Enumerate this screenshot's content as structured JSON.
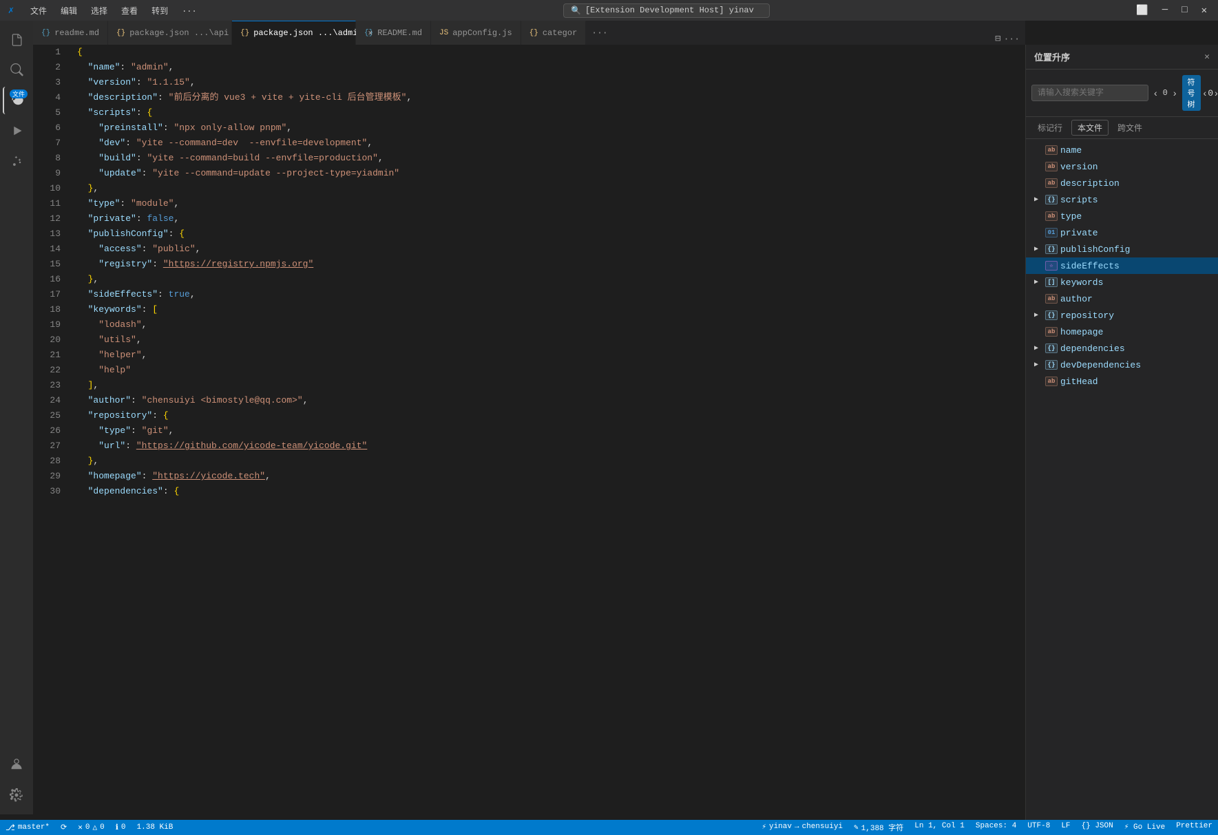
{
  "titlebar": {
    "icon": "✗",
    "menus": [
      "文件",
      "编辑",
      "选择",
      "查看",
      "转到",
      "..."
    ],
    "search_text": "[Extension Development Host] yinav",
    "window_controls": [
      "─",
      "□",
      "✕"
    ]
  },
  "tabs": [
    {
      "id": "readme",
      "icon": "{}",
      "label": "readme.md",
      "active": false,
      "modified": false
    },
    {
      "id": "package-api",
      "icon": "{}",
      "label": "package.json ...\\api",
      "active": false,
      "modified": false
    },
    {
      "id": "package-admin",
      "icon": "{}",
      "label": "package.json ...\\admin",
      "active": true,
      "modified": false
    },
    {
      "id": "readme2",
      "icon": "{}",
      "label": "README.md",
      "active": false,
      "modified": false
    },
    {
      "id": "appconfig",
      "icon": "JS",
      "label": "appConfig.js",
      "active": false,
      "modified": false
    },
    {
      "id": "categor",
      "icon": "{}",
      "label": "categor",
      "active": false,
      "modified": false
    }
  ],
  "editor": {
    "lines": [
      {
        "num": 1,
        "content": "{"
      },
      {
        "num": 2,
        "content": "  \"name\": \"admin\","
      },
      {
        "num": 3,
        "content": "  \"version\": \"1.1.15\","
      },
      {
        "num": 4,
        "content": "  \"description\": \"前后分离的 vue3 + vite + yite-cli 后台管理模板\","
      },
      {
        "num": 5,
        "content": "  \"scripts\": {"
      },
      {
        "num": 6,
        "content": "    \"preinstall\": \"npx only-allow pnpm\","
      },
      {
        "num": 7,
        "content": "    \"dev\": \"yite --command=dev  --envfile=development\","
      },
      {
        "num": 8,
        "content": "    \"build\": \"yite --command=build --envfile=production\","
      },
      {
        "num": 9,
        "content": "    \"update\": \"yite --command=update --project-type=yiadmin\""
      },
      {
        "num": 10,
        "content": "  },"
      },
      {
        "num": 11,
        "content": "  \"type\": \"module\","
      },
      {
        "num": 12,
        "content": "  \"private\": false,"
      },
      {
        "num": 13,
        "content": "  \"publishConfig\": {"
      },
      {
        "num": 14,
        "content": "    \"access\": \"public\","
      },
      {
        "num": 15,
        "content": "    \"registry\": \"https://registry.npmjs.org\""
      },
      {
        "num": 16,
        "content": "  },"
      },
      {
        "num": 17,
        "content": "  \"sideEffects\": true,"
      },
      {
        "num": 18,
        "content": "  \"keywords\": ["
      },
      {
        "num": 19,
        "content": "    \"lodash\","
      },
      {
        "num": 20,
        "content": "    \"utils\","
      },
      {
        "num": 21,
        "content": "    \"helper\","
      },
      {
        "num": 22,
        "content": "    \"help\""
      },
      {
        "num": 23,
        "content": "  ],"
      },
      {
        "num": 24,
        "content": "  \"author\": \"chensuiyi <bimostyle@qq.com>\","
      },
      {
        "num": 25,
        "content": "  \"repository\": {"
      },
      {
        "num": 26,
        "content": "    \"type\": \"git\","
      },
      {
        "num": 27,
        "content": "    \"url\": \"https://github.com/yicode-team/yicode.git\""
      },
      {
        "num": 28,
        "content": "  },"
      },
      {
        "num": 29,
        "content": "  \"homepage\": \"https://yicode.tech\","
      },
      {
        "num": 30,
        "content": "  \"dependencies\": {"
      }
    ]
  },
  "right_panel": {
    "title": "位置升序",
    "search_placeholder": "请输入搜索关键字",
    "nav_count_left": "0",
    "nav_count_right": "0",
    "search_type_btn": "符号树",
    "filter_btns": [
      "标记行",
      "本文件",
      "跨文件"
    ],
    "active_filter": "本文件",
    "tree_items": [
      {
        "id": "name",
        "label": "name",
        "type": "string",
        "type_label": "ab",
        "indent": 0,
        "arrow": "leaf",
        "expanded": false
      },
      {
        "id": "version",
        "label": "version",
        "type": "string",
        "type_label": "ab",
        "indent": 0,
        "arrow": "leaf",
        "expanded": false
      },
      {
        "id": "description",
        "label": "description",
        "type": "string",
        "type_label": "ab",
        "indent": 0,
        "arrow": "leaf",
        "expanded": false
      },
      {
        "id": "scripts",
        "label": "scripts",
        "type": "object",
        "type_label": "{}",
        "indent": 0,
        "arrow": "collapsed",
        "expanded": false
      },
      {
        "id": "type",
        "label": "type",
        "type": "string",
        "type_label": "ab",
        "indent": 0,
        "arrow": "leaf",
        "expanded": false
      },
      {
        "id": "private",
        "label": "private",
        "type": "bool",
        "type_label": "01",
        "indent": 0,
        "arrow": "leaf",
        "expanded": false
      },
      {
        "id": "publishConfig",
        "label": "publishConfig",
        "type": "object",
        "type_label": "{}",
        "indent": 0,
        "arrow": "collapsed",
        "expanded": false
      },
      {
        "id": "sideEffects",
        "label": "sideEffects",
        "type": "bool",
        "type_label": "☆",
        "indent": 0,
        "arrow": "leaf",
        "expanded": false,
        "selected": true
      },
      {
        "id": "keywords",
        "label": "keywords",
        "type": "array",
        "type_label": "[]",
        "indent": 0,
        "arrow": "collapsed",
        "expanded": false
      },
      {
        "id": "author",
        "label": "author",
        "type": "string",
        "type_label": "ab",
        "indent": 0,
        "arrow": "leaf",
        "expanded": false
      },
      {
        "id": "repository",
        "label": "repository",
        "type": "object",
        "type_label": "{}",
        "indent": 0,
        "arrow": "collapsed",
        "expanded": false
      },
      {
        "id": "homepage",
        "label": "homepage",
        "type": "string",
        "type_label": "ab",
        "indent": 0,
        "arrow": "leaf",
        "expanded": false
      },
      {
        "id": "dependencies",
        "label": "dependencies",
        "type": "object",
        "type_label": "{}",
        "indent": 0,
        "arrow": "collapsed",
        "expanded": false
      },
      {
        "id": "devDependencies",
        "label": "devDependencies",
        "type": "object",
        "type_label": "{}",
        "indent": 0,
        "arrow": "collapsed",
        "expanded": false
      },
      {
        "id": "gitHead",
        "label": "gitHead",
        "type": "string",
        "type_label": "ab",
        "indent": 0,
        "arrow": "leaf",
        "expanded": false
      }
    ]
  },
  "statusbar": {
    "branch": "master*",
    "sync_icon": "⟳",
    "errors": "0",
    "warnings": "0 △",
    "info": "0 ℹ",
    "remote_label": "0",
    "file_size": "1.38 KiB",
    "yinav": "yinav",
    "arrow": "→",
    "chensuiyi": "chensuiyi",
    "edit_icon": "✎",
    "char_count": "1,388 字符",
    "position": "Ln 1, Col 1",
    "spaces": "Spaces: 4",
    "encoding": "UTF-8",
    "line_ending": "LF",
    "language": "{} JSON",
    "go_live": "⚡ Go Live",
    "prettier": "Prettier"
  }
}
